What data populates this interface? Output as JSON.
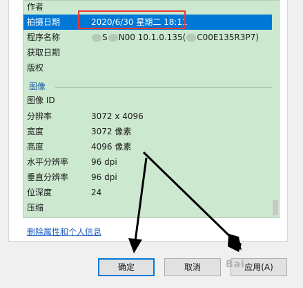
{
  "properties": {
    "rows": [
      {
        "name": "作者",
        "value": ""
      },
      {
        "name": "拍摄日期",
        "value": "2020/6/30 星期二 18:11"
      },
      {
        "name": "程序名称",
        "value_prefix": "S",
        "value_mid": "N00 10.1.0.135(",
        "value_suffix": "C00E135R3P7)"
      },
      {
        "name": "获取日期",
        "value": ""
      },
      {
        "name": "版权",
        "value": ""
      }
    ],
    "image_group": "图像",
    "image_rows": [
      {
        "name": "图像 ID",
        "value": ""
      },
      {
        "name": "分辨率",
        "value": "3072 x 4096"
      },
      {
        "name": "宽度",
        "value": "3072 像素"
      },
      {
        "name": "高度",
        "value": "4096 像素"
      },
      {
        "name": "水平分辨率",
        "value": "96 dpi"
      },
      {
        "name": "垂直分辨率",
        "value": "96 dpi"
      },
      {
        "name": "位深度",
        "value": "24"
      },
      {
        "name": "压缩",
        "value": ""
      }
    ]
  },
  "remove_link": "删除属性和个人信息",
  "buttons": {
    "ok": "确定",
    "cancel": "取消",
    "apply": "应用(A)"
  },
  "watermark": "Bai"
}
